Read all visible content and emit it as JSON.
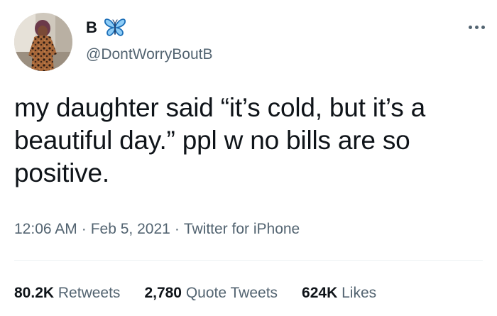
{
  "user": {
    "display_name": "B",
    "handle": "@DontWorryBoutB",
    "avatar_icon": "profile-photo",
    "name_emoji": "blue-butterfly-icon"
  },
  "tweet": {
    "text": "my daughter said “it’s cold, but it’s a beautiful day.” ppl w no bills are so positive.",
    "time": "12:06 AM",
    "date": "Feb 5, 2021",
    "source": "Twitter for iPhone"
  },
  "stats": {
    "retweets_count": "80.2K",
    "retweets_label": "Retweets",
    "quote_tweets_count": "2,780",
    "quote_tweets_label": "Quote Tweets",
    "likes_count": "624K",
    "likes_label": "Likes"
  },
  "colors": {
    "text_primary": "#0f1419",
    "text_secondary": "#536471",
    "divider": "#eff3f4",
    "butterfly": "#1d9bf0"
  }
}
